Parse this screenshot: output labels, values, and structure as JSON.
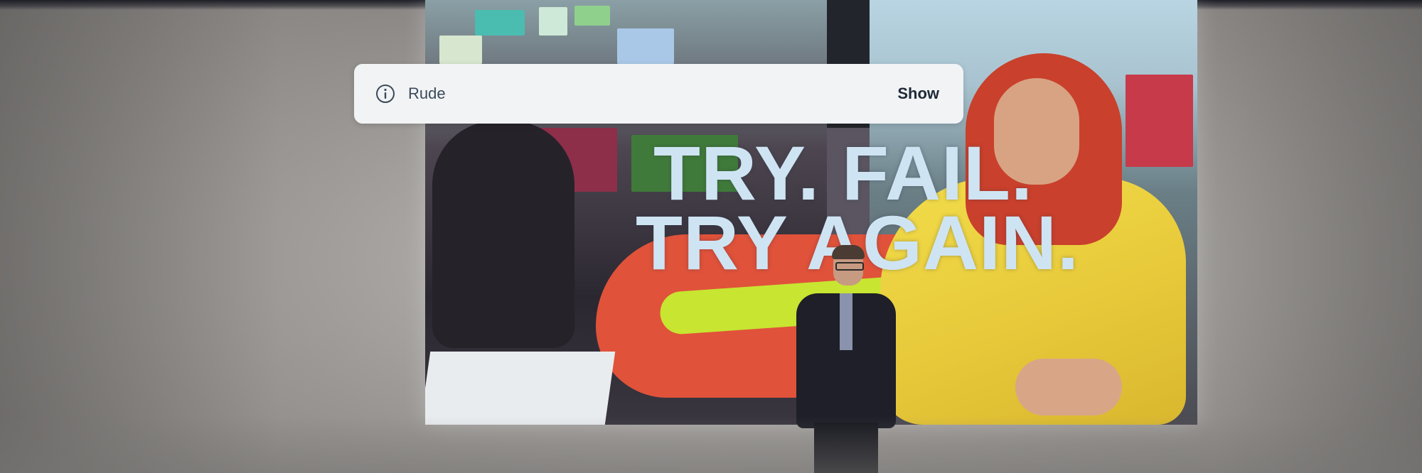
{
  "notice": {
    "icon": "info-icon",
    "label": "Rude",
    "action_label": "Show"
  },
  "slide": {
    "line1": "TRY. FAIL.",
    "line2": "TRY AGAIN."
  },
  "colors": {
    "banner_background": "#f1f3f5",
    "banner_text": "#3b4a5a",
    "action_text": "#1f2a37",
    "slide_text": "#cfe4f3"
  }
}
